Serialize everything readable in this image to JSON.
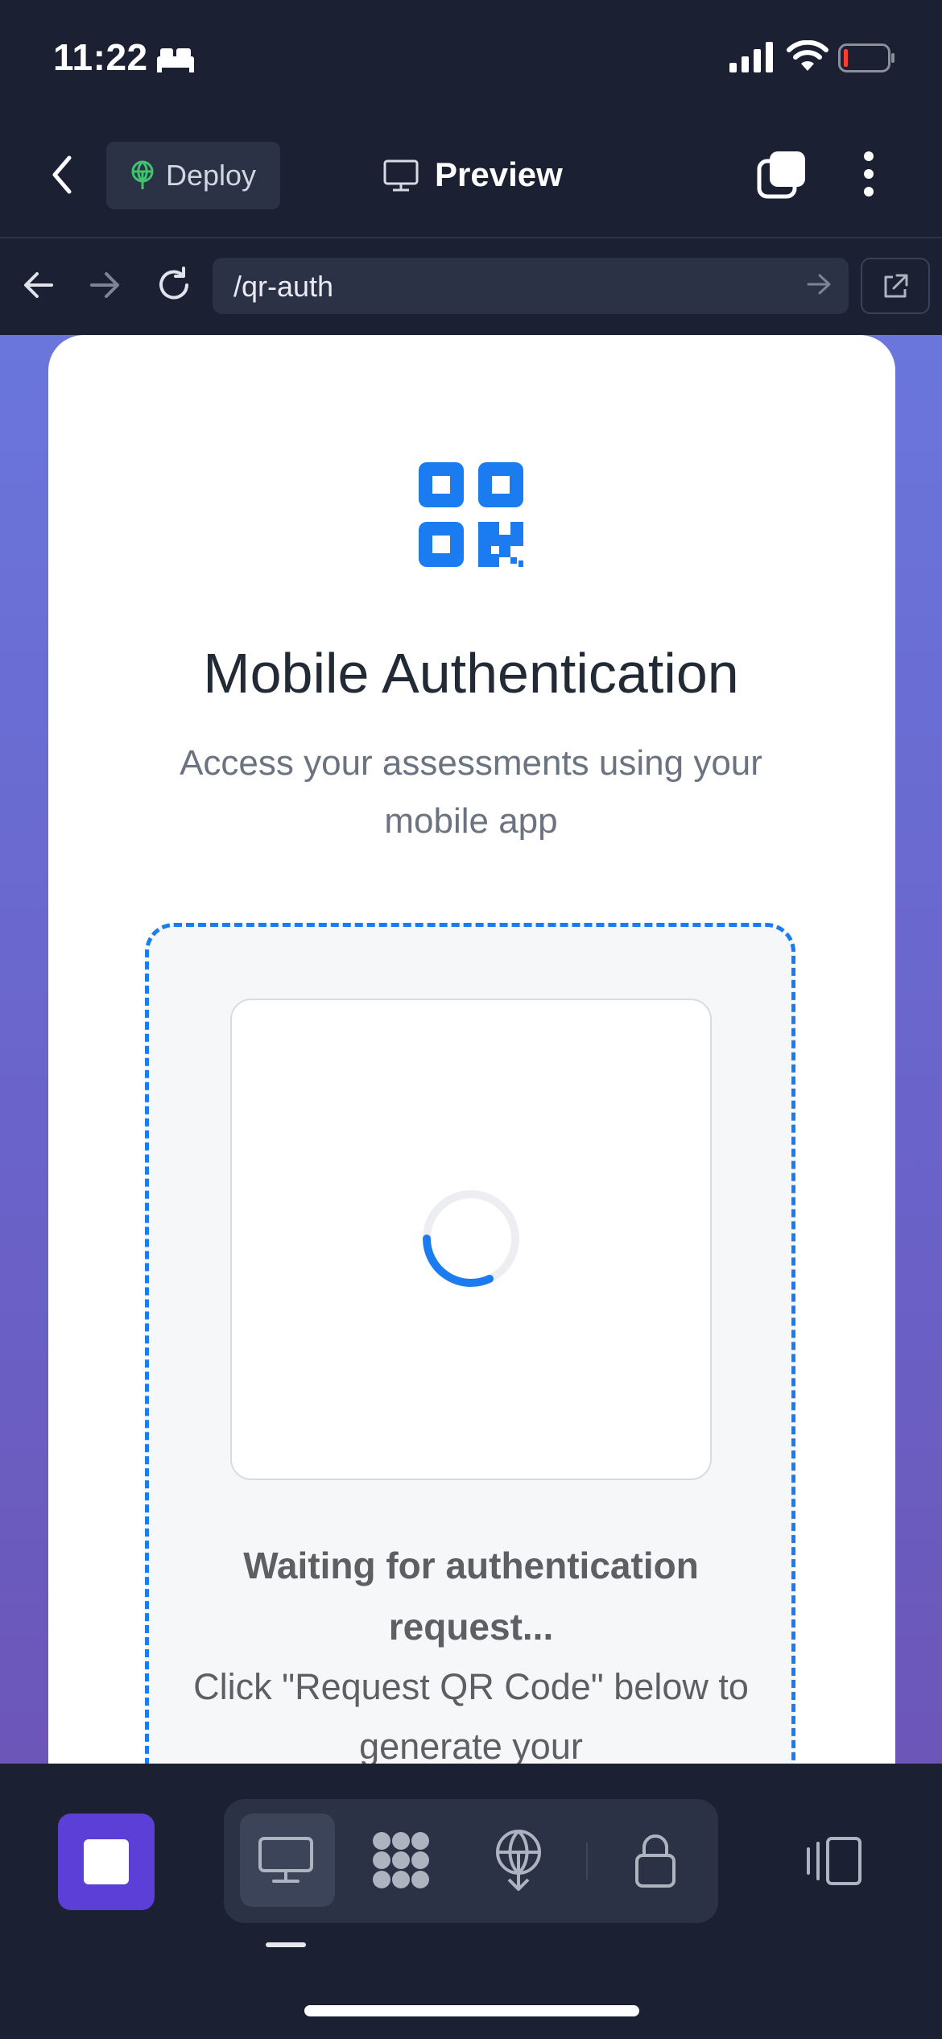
{
  "status_bar": {
    "time": "11:22"
  },
  "top_bar": {
    "deploy_label": "Deploy",
    "title": "Preview"
  },
  "address_bar": {
    "url": "/qr-auth"
  },
  "page": {
    "title": "Mobile Authentication",
    "subtitle": "Access your assessments using your mobile app",
    "waiting_text": "Waiting for authentication request...",
    "instruction_text": "Click \"Request QR Code\" below to generate your"
  },
  "colors": {
    "accent": "#1a7cf0",
    "stop_button": "#5b3fd6",
    "app_bg": "#1b2032"
  },
  "icons": [
    "bed-icon",
    "signal-icon",
    "wifi-icon",
    "battery-icon",
    "back-icon",
    "deploy-icon",
    "preview-icon",
    "tabs-icon",
    "more-icon",
    "nav-back-icon",
    "nav-forward-icon",
    "reload-icon",
    "url-go-icon",
    "open-external-icon",
    "qr-code-icon",
    "spinner-icon",
    "stop-icon",
    "desktop-icon",
    "cluster-icon",
    "deploy-tool-icon",
    "lock-icon",
    "side-panel-icon"
  ]
}
